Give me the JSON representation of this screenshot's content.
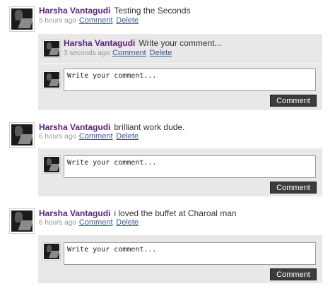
{
  "posts": [
    {
      "author": "Harsha Vantagudi",
      "message": "Testing the Seconds",
      "time": "5 hours ago",
      "comment_link": "Comment",
      "delete_link": "Delete",
      "reply": {
        "author": "Harsha Vantagudi",
        "message": "Write your comment...",
        "time": "3 seconds ago",
        "comment_link": "Comment",
        "delete_link": "Delete"
      },
      "composer_placeholder": "Write your comment...",
      "composer_button": "Comment"
    },
    {
      "author": "Harsha Vantagudi",
      "message": "brilliant work dude.",
      "time": "6 hours ago",
      "comment_link": "Comment",
      "delete_link": "Delete",
      "composer_placeholder": "Write your comment...",
      "composer_button": "Comment"
    },
    {
      "author": "Harsha Vantagudi",
      "message": "i loved the buffet at Charoal man",
      "time": "6 hours ago",
      "comment_link": "Comment",
      "delete_link": "Delete",
      "composer_placeholder": "Write your comment...",
      "composer_button": "Comment"
    }
  ]
}
